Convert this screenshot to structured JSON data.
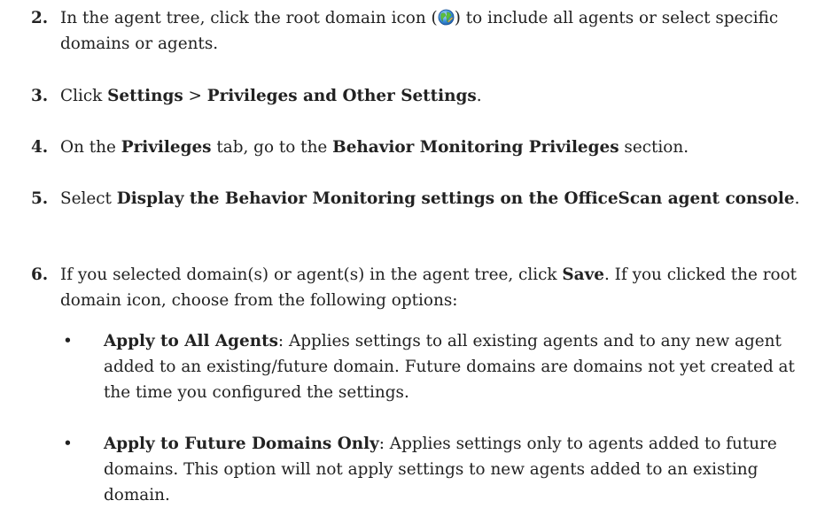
{
  "steps": [
    {
      "num": "2.",
      "text_before": "In the agent tree, click the root domain icon (",
      "text_after": ") to include all agents or select specific domains or agents."
    },
    {
      "num": "3.",
      "t1": "Click ",
      "b1": "Settings",
      "t2": " > ",
      "b2": "Privileges and Other Settings",
      "t3": "."
    },
    {
      "num": "4.",
      "t1": "On the ",
      "b1": "Privileges",
      "t2": " tab, go to the ",
      "b2": "Behavior Monitoring Privileges",
      "t3": " section."
    },
    {
      "num": "5.",
      "t1": "Select ",
      "b1": "Display the Behavior Monitoring settings on the OfficeScan agent console",
      "t2": "."
    },
    {
      "num": "6.",
      "t1": "If you selected domain(s) or agent(s) in the agent tree, click ",
      "b1": "Save",
      "t2": ". If you clicked the root domain icon, choose from the following options:"
    }
  ],
  "options": [
    {
      "bullet": "•",
      "label": "Apply to All Agents",
      "desc": ": Applies settings to all existing agents and to any new agent added to an existing/future domain. Future domains are domains not yet created at the time you configured the settings."
    },
    {
      "bullet": "•",
      "label": "Apply to Future Domains Only",
      "desc": ": Applies settings only to agents added to future domains. This option will not apply settings to new agents added to an existing domain."
    }
  ],
  "icons": {
    "root_domain": "globe-icon"
  }
}
